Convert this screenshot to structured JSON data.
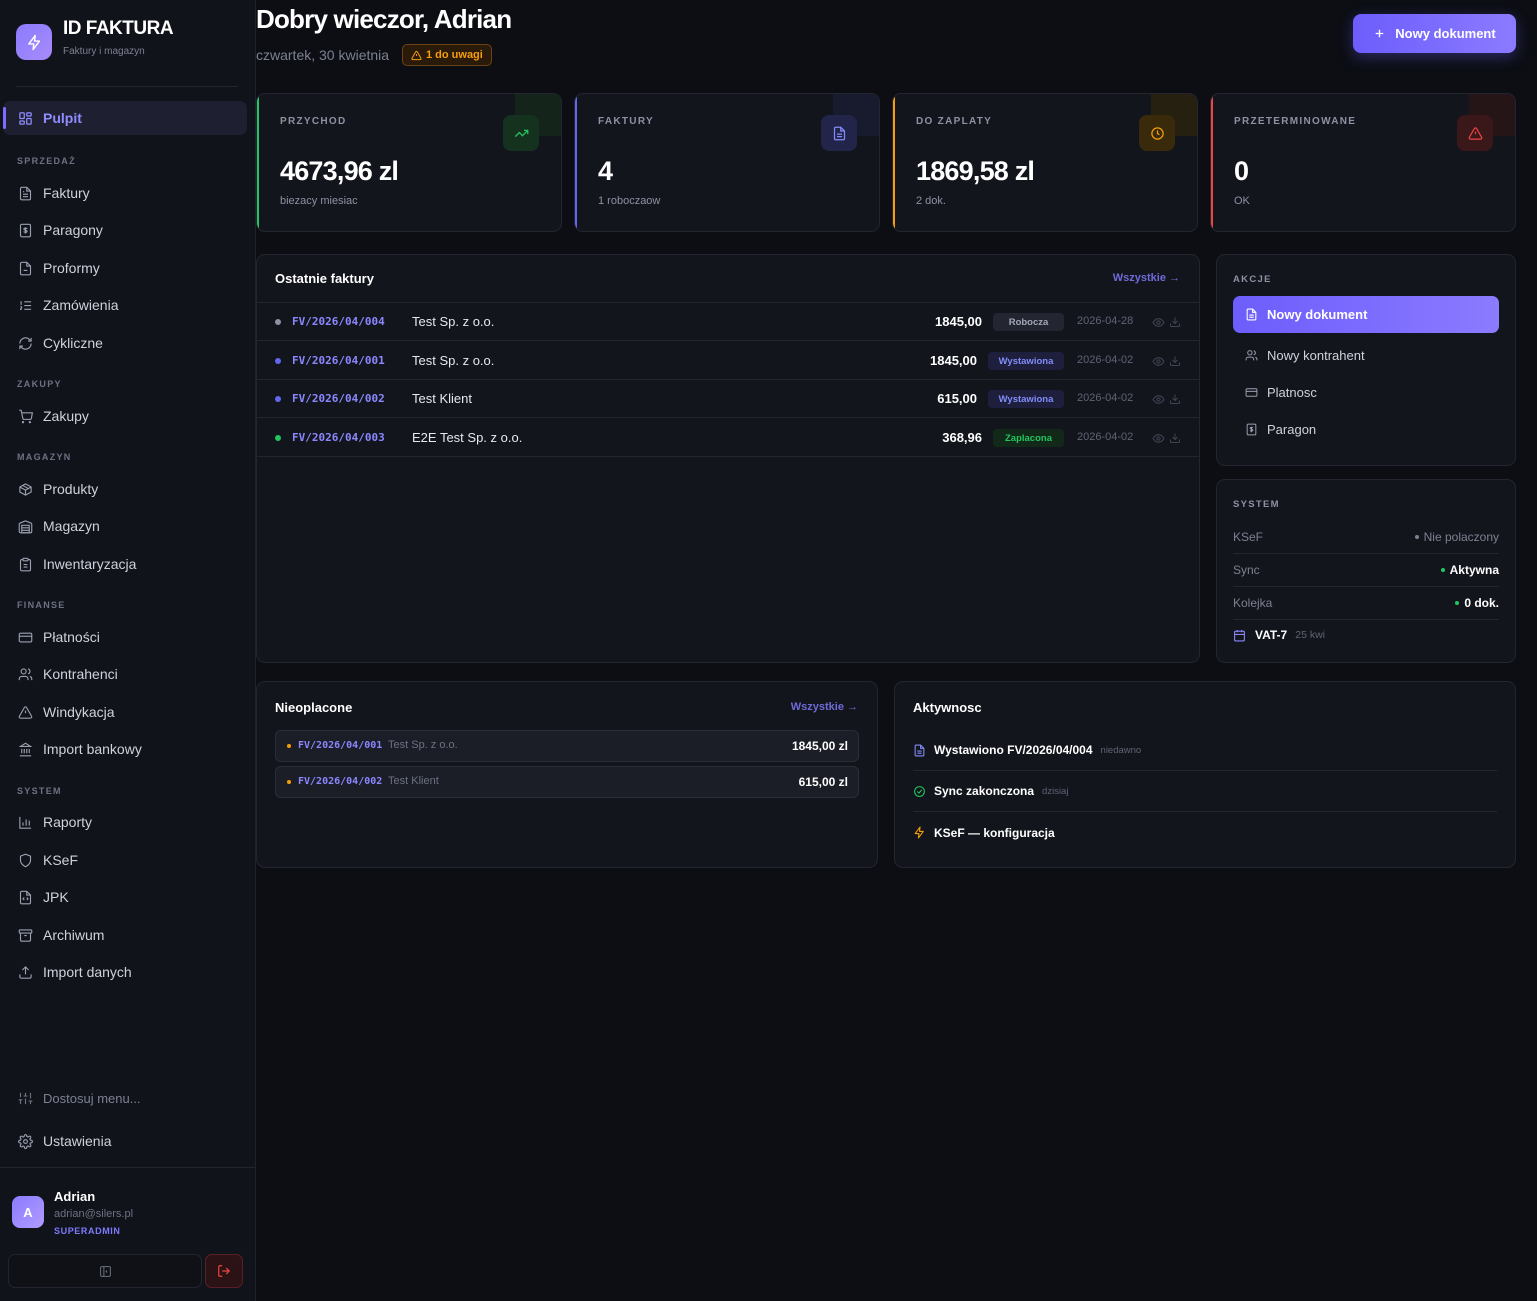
{
  "brand": {
    "title": "ID FAKTURA",
    "subtitle": "Faktury i magazyn"
  },
  "sidebar": {
    "top_item": "Pulpit",
    "sections": {
      "sales": "SPRZEDAŻ",
      "purchases": "ZAKUPY",
      "warehouse": "MAGAZYN",
      "finance": "FINANSE",
      "system": "SYSTEM"
    },
    "items": {
      "invoices": "Faktury",
      "receipts": "Paragony",
      "proformas": "Proformy",
      "orders": "Zamówienia",
      "recurring": "Cykliczne",
      "purchases": "Zakupy",
      "products": "Produkty",
      "warehouse": "Magazyn",
      "inventory": "Inwentaryzacja",
      "payments": "Płatności",
      "contractors": "Kontrahenci",
      "collection": "Windykacja",
      "bank_import": "Import bankowy",
      "reports": "Raporty",
      "ksef": "KSeF",
      "jpk": "JPK",
      "archive": "Archiwum",
      "data_import": "Import danych"
    },
    "customize": "Dostosuj menu...",
    "settings": "Ustawienia"
  },
  "user": {
    "initial": "A",
    "name": "Adrian",
    "email": "adrian@silers.pl",
    "role": "SUPERADMIN"
  },
  "header": {
    "greeting": "Dobry wieczor, Adrian",
    "date": "czwartek, 30 kwietnia",
    "alert": "1 do uwagi",
    "new_doc": "Nowy dokument"
  },
  "stats": [
    {
      "label": "PRZYCHOD",
      "value": "4673,96 zl",
      "sub": "biezacy miesiac"
    },
    {
      "label": "FAKTURY",
      "value": "4",
      "sub": "1 roboczaow"
    },
    {
      "label": "DO ZAPLATY",
      "value": "1869,58 zl",
      "sub": "2 dok."
    },
    {
      "label": "PRZETERMINOWANE",
      "value": "0",
      "sub": "OK"
    }
  ],
  "recent": {
    "title": "Ostatnie faktury",
    "link": "Wszystkie →",
    "rows": [
      {
        "no": "FV/2026/04/004",
        "client": "Test Sp. z o.o.",
        "amount": "1845,00",
        "status": "Robocza",
        "date": "2026-04-28"
      },
      {
        "no": "FV/2026/04/001",
        "client": "Test Sp. z o.o.",
        "amount": "1845,00",
        "status": "Wystawiona",
        "date": "2026-04-02"
      },
      {
        "no": "FV/2026/04/002",
        "client": "Test Klient",
        "amount": "615,00",
        "status": "Wystawiona",
        "date": "2026-04-02"
      },
      {
        "no": "FV/2026/04/003",
        "client": "E2E Test Sp. z o.o.",
        "amount": "368,96",
        "status": "Zaplacona",
        "date": "2026-04-02"
      }
    ]
  },
  "actions": {
    "label": "AKCJE",
    "primary": "Nowy dokument",
    "items": [
      "Nowy kontrahent",
      "Platnosc",
      "Paragon"
    ]
  },
  "system": {
    "label": "SYSTEM",
    "rows": [
      {
        "key": "KSeF",
        "value": "Nie polaczony"
      },
      {
        "key": "Sync",
        "value": "Aktywna"
      },
      {
        "key": "Kolejka",
        "value": "0 dok."
      }
    ],
    "vat_label": "VAT-7",
    "vat_date": "25 kwi"
  },
  "unpaid": {
    "title": "Nieoplacone",
    "link": "Wszystkie →",
    "rows": [
      {
        "no": "FV/2026/04/001",
        "client": "Test Sp. z o.o.",
        "amount": "1845,00 zl"
      },
      {
        "no": "FV/2026/04/002",
        "client": "Test Klient",
        "amount": "615,00 zl"
      }
    ]
  },
  "activity": {
    "title": "Aktywnosc",
    "rows": [
      {
        "text": "Wystawiono FV/2026/04/004",
        "time": "niedawno"
      },
      {
        "text": "Sync zakonczona",
        "time": "dzisiaj"
      },
      {
        "text": "KSeF — konfiguracja",
        "time": ""
      }
    ]
  },
  "colors": {
    "accent": "#7c6cff",
    "green": "#22c55e",
    "blue": "#6366f1",
    "orange": "#f59e0b",
    "red": "#ef4444",
    "background": "#0c0e14"
  }
}
